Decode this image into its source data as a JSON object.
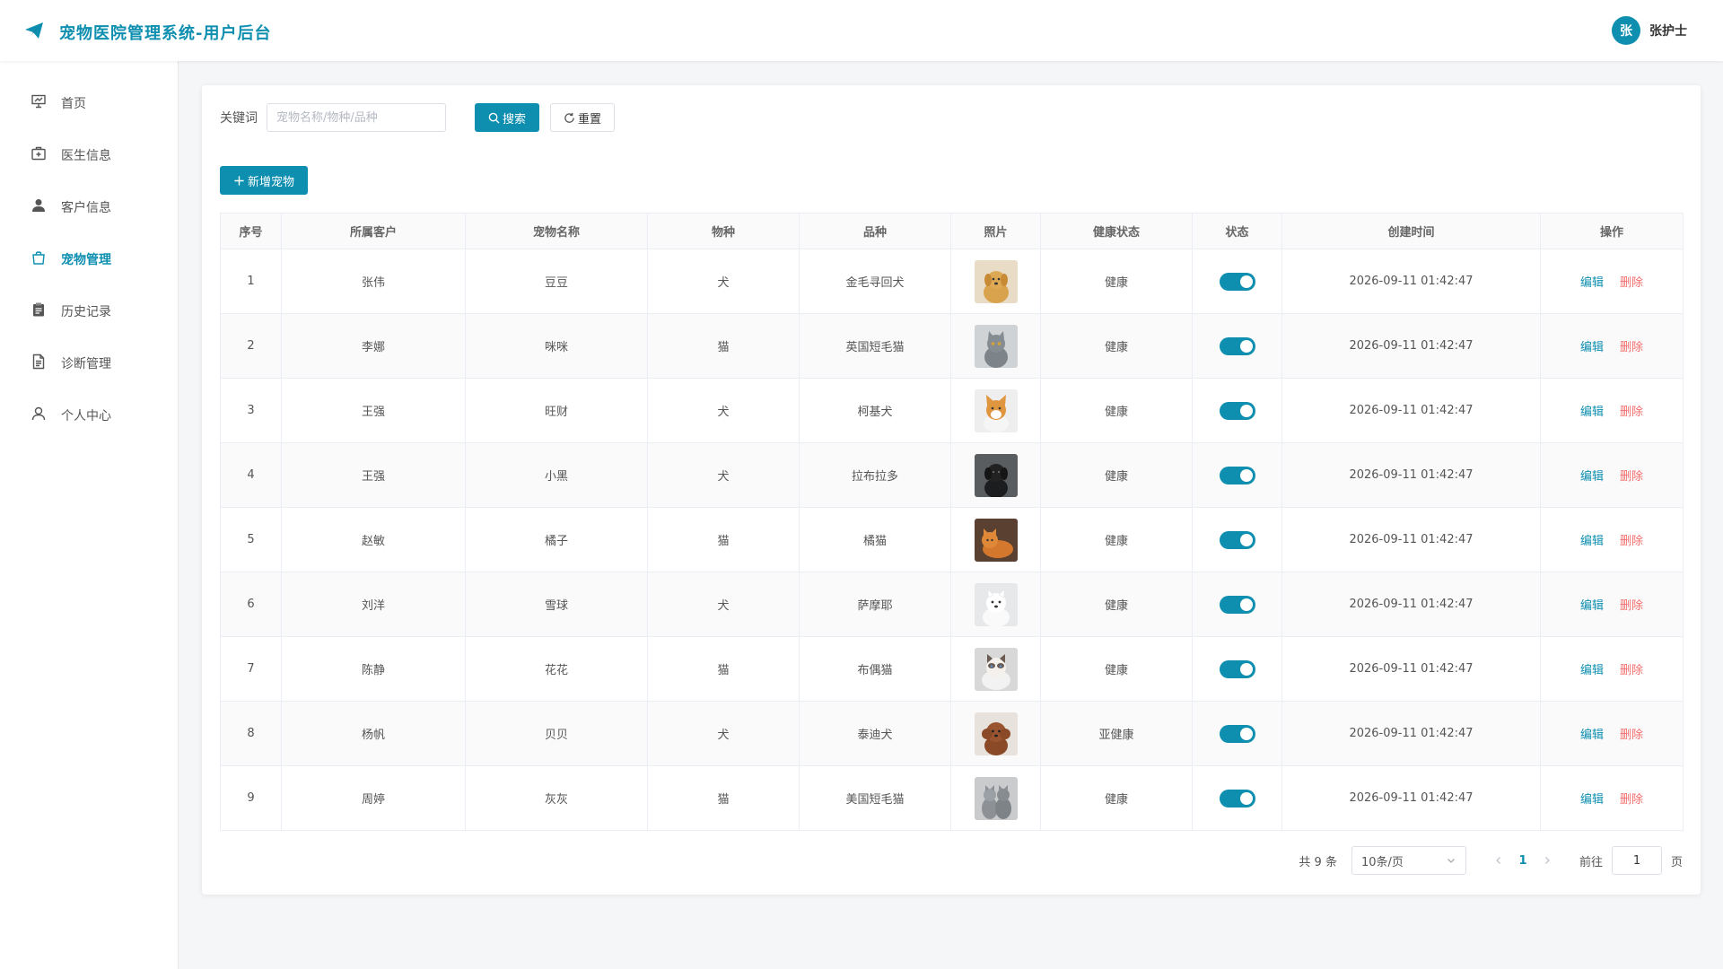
{
  "header": {
    "title": "宠物医院管理系统-用户后台",
    "user_avatar": "张",
    "user_name": "张护士"
  },
  "sidebar": {
    "items": [
      {
        "label": "首页",
        "icon": "presentation-icon"
      },
      {
        "label": "医生信息",
        "icon": "medical-kit-icon"
      },
      {
        "label": "客户信息",
        "icon": "user-icon"
      },
      {
        "label": "宠物管理",
        "icon": "bag-icon",
        "active": true
      },
      {
        "label": "历史记录",
        "icon": "clipboard-icon"
      },
      {
        "label": "诊断管理",
        "icon": "document-icon"
      },
      {
        "label": "个人中心",
        "icon": "user-outline-icon"
      }
    ]
  },
  "search": {
    "label": "关键词",
    "placeholder": "宠物名称/物种/品种",
    "value": "",
    "search_btn": "搜索",
    "reset_btn": "重置"
  },
  "toolbar": {
    "add_btn": "新增宠物"
  },
  "table": {
    "columns": [
      "序号",
      "所属客户",
      "宠物名称",
      "物种",
      "品种",
      "照片",
      "健康状态",
      "状态",
      "创建时间",
      "操作"
    ],
    "edit_label": "编辑",
    "delete_label": "删除",
    "rows": [
      {
        "no": "1",
        "owner": "张伟",
        "name": "豆豆",
        "species": "犬",
        "breed": "金毛寻回犬",
        "health": "健康",
        "enabled": true,
        "created": "2026-09-11 01:42:47"
      },
      {
        "no": "2",
        "owner": "李娜",
        "name": "咪咪",
        "species": "猫",
        "breed": "英国短毛猫",
        "health": "健康",
        "enabled": true,
        "created": "2026-09-11 01:42:47"
      },
      {
        "no": "3",
        "owner": "王强",
        "name": "旺财",
        "species": "犬",
        "breed": "柯基犬",
        "health": "健康",
        "enabled": true,
        "created": "2026-09-11 01:42:47"
      },
      {
        "no": "4",
        "owner": "王强",
        "name": "小黑",
        "species": "犬",
        "breed": "拉布拉多",
        "health": "健康",
        "enabled": true,
        "created": "2026-09-11 01:42:47"
      },
      {
        "no": "5",
        "owner": "赵敏",
        "name": "橘子",
        "species": "猫",
        "breed": "橘猫",
        "health": "健康",
        "enabled": true,
        "created": "2026-09-11 01:42:47"
      },
      {
        "no": "6",
        "owner": "刘洋",
        "name": "雪球",
        "species": "犬",
        "breed": "萨摩耶",
        "health": "健康",
        "enabled": true,
        "created": "2026-09-11 01:42:47"
      },
      {
        "no": "7",
        "owner": "陈静",
        "name": "花花",
        "species": "猫",
        "breed": "布偶猫",
        "health": "健康",
        "enabled": true,
        "created": "2026-09-11 01:42:47"
      },
      {
        "no": "8",
        "owner": "杨帆",
        "name": "贝贝",
        "species": "犬",
        "breed": "泰迪犬",
        "health": "亚健康",
        "enabled": true,
        "created": "2026-09-11 01:42:47"
      },
      {
        "no": "9",
        "owner": "周婷",
        "name": "灰灰",
        "species": "猫",
        "breed": "美国短毛猫",
        "health": "健康",
        "enabled": true,
        "created": "2026-09-11 01:42:47"
      }
    ]
  },
  "pagination": {
    "total_text": "共 9 条",
    "page_size": "10条/页",
    "current_page": "1",
    "goto_label": "前往",
    "goto_value": "1",
    "goto_suffix": "页"
  },
  "colors": {
    "primary": "#0e8fb0",
    "danger": "#f56c6c"
  }
}
